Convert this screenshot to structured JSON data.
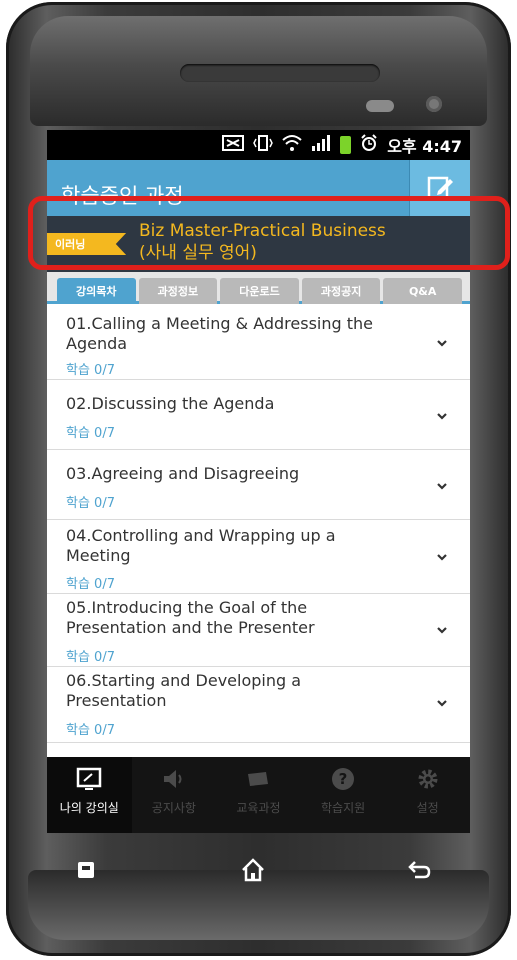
{
  "status_bar": {
    "time": "오후 4:47"
  },
  "header": {
    "title": "학습중인 과정"
  },
  "course": {
    "tag": "이러닝",
    "title_line1": "Biz Master-Practical Business",
    "title_line2": "(사내 실무 영어)"
  },
  "tabs": [
    {
      "label": "강의목차",
      "active": true
    },
    {
      "label": "과정정보"
    },
    {
      "label": "다운로드"
    },
    {
      "label": "과정공지"
    },
    {
      "label": "Q&A"
    }
  ],
  "lessons": [
    {
      "line1": "01.Calling a Meeting & Addressing the",
      "line2": "Agenda",
      "progress": "학습 0/7"
    },
    {
      "line1": "02.Discussing the Agenda",
      "line2": "",
      "progress": "학습 0/7"
    },
    {
      "line1": "03.Agreeing and Disagreeing",
      "line2": "",
      "progress": "학습 0/7"
    },
    {
      "line1": "04.Controlling and Wrapping up a",
      "line2": "Meeting",
      "progress": "학습 0/7"
    },
    {
      "line1": "05.Introducing the Goal of the",
      "line2": "Presentation and the Presenter",
      "progress": "학습 0/7"
    },
    {
      "line1": "06.Starting and Developing a",
      "line2": "Presentation",
      "progress": "학습 0/7"
    }
  ],
  "bottom_nav": [
    {
      "label": "나의 강의실",
      "icon": "classroom-icon",
      "active": true
    },
    {
      "label": "공지사항",
      "icon": "speaker-icon"
    },
    {
      "label": "교육과정",
      "icon": "course-icon"
    },
    {
      "label": "학습지원",
      "icon": "help-icon"
    },
    {
      "label": "설정",
      "icon": "gear-icon"
    }
  ],
  "colors": {
    "accent": "#4fa3cf",
    "course_bar": "#2e3742",
    "course_text": "#f4b81f",
    "highlight": "#e0201b"
  }
}
